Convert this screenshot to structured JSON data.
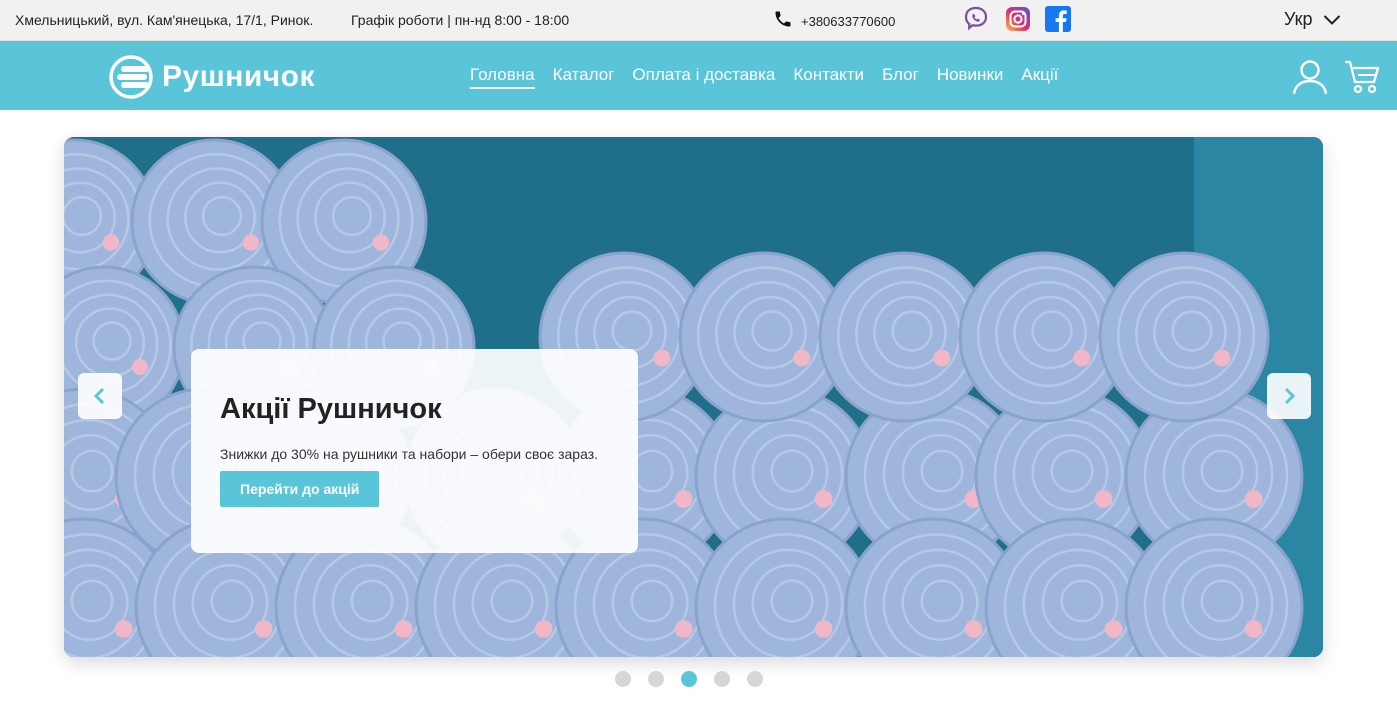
{
  "topbar": {
    "address": "Хмельницький, вул. Кам'янецька, 17/1, Ринок.",
    "hours": "Графік роботи | пн-нд 8:00 - 18:00",
    "phone": "+380633770600",
    "language": "Укр"
  },
  "header": {
    "logo_text": "Рушничок",
    "nav": [
      {
        "label": "Головна",
        "active": true
      },
      {
        "label": "Каталог"
      },
      {
        "label": "Оплата і доставка"
      },
      {
        "label": "Контакти"
      },
      {
        "label": "Блог"
      },
      {
        "label": "Новинки"
      },
      {
        "label": "Акції"
      }
    ]
  },
  "hero": {
    "title": "Акції Рушничок",
    "text": "Знижки до 30% на рушники та набори – обери своє зараз.",
    "button_label": "Перейти до акцій",
    "slides_total": 5,
    "active_slide": 3
  },
  "colors": {
    "accent": "#5ac5d8",
    "towel": "#9fb6dc",
    "shelf": "#1f6f8a"
  },
  "icons": {
    "phone": "phone-icon",
    "viber": "viber-icon",
    "instagram": "instagram-icon",
    "facebook": "facebook-icon",
    "chevron": "chevron-down-icon",
    "user": "user-icon",
    "cart": "cart-icon"
  }
}
